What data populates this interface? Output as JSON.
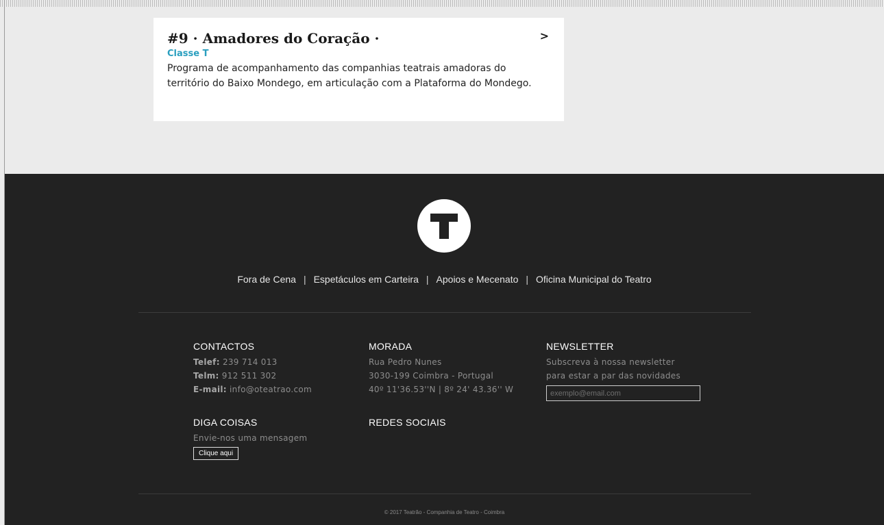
{
  "card": {
    "title": "#9 · Amadores do Coração ·",
    "arrow": ">",
    "tag": "Classe T",
    "description": "Programa de acompanhamento das companhias teatrais amadoras do território do Baixo Mondego, em articulação com a Plataforma do Mondego."
  },
  "footer": {
    "logo_letter": "T",
    "nav": [
      "Fora de Cena",
      "Espetáculos em Carteira",
      "Apoios e Mecenato",
      "Oficina Municipal do Teatro"
    ],
    "nav_separator": "|",
    "contactos": {
      "heading": "CONTACTOS",
      "telef_label": "Telef:",
      "telef_value": "239 714 013",
      "telm_label": "Telm:",
      "telm_value": "912 511 302",
      "email_label": "E-mail:",
      "email_value": "info@oteatrao.com"
    },
    "morada": {
      "heading": "MORADA",
      "line1": "Rua Pedro Nunes",
      "line2": "3030-199 Coimbra - Portugal",
      "line3": "40º 11'36.53''N | 8º 24' 43.36'' W"
    },
    "newsletter": {
      "heading": "NEWSLETTER",
      "line1": "Subscreva à nossa newsletter",
      "line2": "para estar a par das novidades",
      "placeholder": "exemplo@email.com"
    },
    "diga_coisas": {
      "heading": "DIGA COISAS",
      "line1": "Envie-nos uma mensagem",
      "button": "Clique aqui"
    },
    "redes_sociais": {
      "heading": "REDES SOCIAIS"
    },
    "copyright": "© 2017 Teatrão - Companhia de Teatro - Coimbra"
  },
  "colors": {
    "page_bg": "#ebebeb",
    "footer_bg": "#222222",
    "accent": "#2a9fbf"
  }
}
